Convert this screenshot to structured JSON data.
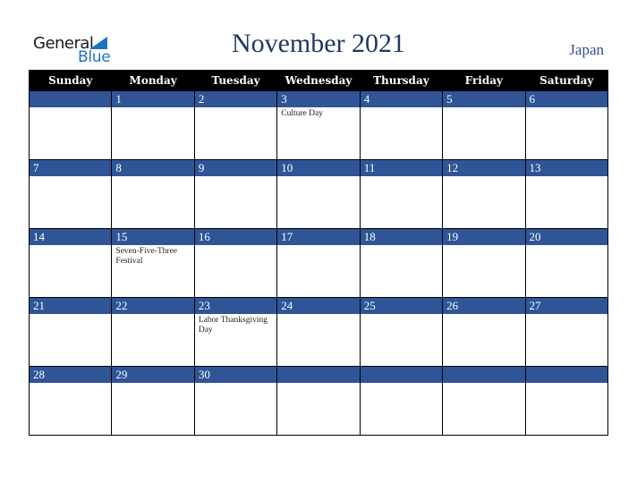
{
  "logo": {
    "general": "General",
    "blue": "Blue"
  },
  "title": "November 2021",
  "country": "Japan",
  "colors": {
    "header_bg": "#000000",
    "daybar_bg": "#2f5597",
    "title": "#1f3864",
    "logo_blue": "#1e73be"
  },
  "weekdays": [
    "Sunday",
    "Monday",
    "Tuesday",
    "Wednesday",
    "Thursday",
    "Friday",
    "Saturday"
  ],
  "weeks": [
    [
      {
        "day": "",
        "event": ""
      },
      {
        "day": "1",
        "event": ""
      },
      {
        "day": "2",
        "event": ""
      },
      {
        "day": "3",
        "event": "Culture Day"
      },
      {
        "day": "4",
        "event": ""
      },
      {
        "day": "5",
        "event": ""
      },
      {
        "day": "6",
        "event": ""
      }
    ],
    [
      {
        "day": "7",
        "event": ""
      },
      {
        "day": "8",
        "event": ""
      },
      {
        "day": "9",
        "event": ""
      },
      {
        "day": "10",
        "event": ""
      },
      {
        "day": "11",
        "event": ""
      },
      {
        "day": "12",
        "event": ""
      },
      {
        "day": "13",
        "event": ""
      }
    ],
    [
      {
        "day": "14",
        "event": ""
      },
      {
        "day": "15",
        "event": "Seven-Five-Three Festival"
      },
      {
        "day": "16",
        "event": ""
      },
      {
        "day": "17",
        "event": ""
      },
      {
        "day": "18",
        "event": ""
      },
      {
        "day": "19",
        "event": ""
      },
      {
        "day": "20",
        "event": ""
      }
    ],
    [
      {
        "day": "21",
        "event": ""
      },
      {
        "day": "22",
        "event": ""
      },
      {
        "day": "23",
        "event": "Labor Thanksgiving Day"
      },
      {
        "day": "24",
        "event": ""
      },
      {
        "day": "25",
        "event": ""
      },
      {
        "day": "26",
        "event": ""
      },
      {
        "day": "27",
        "event": ""
      }
    ],
    [
      {
        "day": "28",
        "event": ""
      },
      {
        "day": "29",
        "event": ""
      },
      {
        "day": "30",
        "event": ""
      },
      {
        "day": "",
        "event": ""
      },
      {
        "day": "",
        "event": ""
      },
      {
        "day": "",
        "event": ""
      },
      {
        "day": "",
        "event": ""
      }
    ]
  ]
}
